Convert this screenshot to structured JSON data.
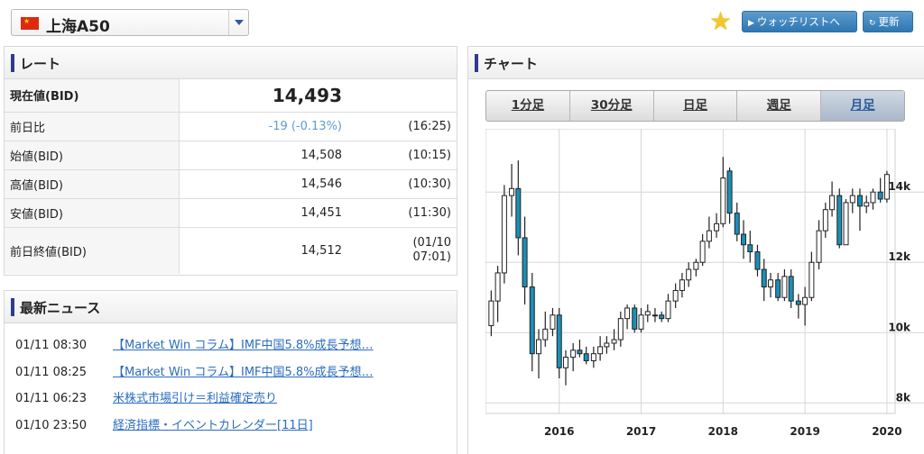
{
  "header": {
    "symbol": "上海A50",
    "flag_icon": "china-flag-icon",
    "watchlist_label": "ウォッチリストへ",
    "refresh_label": "更新"
  },
  "rate": {
    "title": "レート",
    "rows": [
      {
        "label": "現在値(BID)",
        "value": "14,493",
        "time": ""
      },
      {
        "label": "前日比",
        "value": "-19 (-0.13%)",
        "time": "(16:25)"
      },
      {
        "label": "始値(BID)",
        "value": "14,508",
        "time": "(10:15)"
      },
      {
        "label": "高値(BID)",
        "value": "14,546",
        "time": "(10:30)"
      },
      {
        "label": "安値(BID)",
        "value": "14,451",
        "time": "(11:30)"
      },
      {
        "label": "前日終値(BID)",
        "value": "14,512",
        "time_line1": "(01/10",
        "time_line2": "07:01)"
      }
    ]
  },
  "news": {
    "title": "最新ニュース",
    "items": [
      {
        "time": "01/11 08:30",
        "headline": "【Market Win コラム】IMF中国5.8%成長予想…"
      },
      {
        "time": "01/11 08:25",
        "headline": "【Market Win コラム】IMF中国5.8%成長予想…"
      },
      {
        "time": "01/11 06:23",
        "headline": "米株式市場引け＝利益確定売り"
      },
      {
        "time": "01/10 23:50",
        "headline": "経済指標・イベントカレンダー[11日]"
      }
    ]
  },
  "chart": {
    "title": "チャート",
    "tabs": [
      "1分足",
      "30分足",
      "日足",
      "週足",
      "月足"
    ],
    "active_tab": 4
  },
  "colors": {
    "up": "#ffffff",
    "down": "#1b8fb8",
    "grid": "#d6d6d6",
    "accent": "#2d3d8a"
  },
  "chart_data": {
    "type": "candlestick",
    "x_ticks": [
      "2016",
      "2017",
      "2018",
      "2019",
      "2020"
    ],
    "y_ticks": [
      "8k",
      "10k",
      "12k",
      "14k"
    ],
    "y_tick_values": [
      8000,
      10000,
      12000,
      14000
    ],
    "ylim": [
      7700,
      15800
    ],
    "xlim": [
      2015.1,
      2020.1
    ],
    "candles": [
      {
        "t": 2015.17,
        "o": 10200,
        "h": 11200,
        "l": 9900,
        "c": 10900
      },
      {
        "t": 2015.25,
        "o": 10900,
        "h": 11900,
        "l": 10300,
        "c": 11700
      },
      {
        "t": 2015.33,
        "o": 11700,
        "h": 14200,
        "l": 11400,
        "c": 13900
      },
      {
        "t": 2015.42,
        "o": 13900,
        "h": 14800,
        "l": 13300,
        "c": 14100
      },
      {
        "t": 2015.5,
        "o": 14100,
        "h": 14900,
        "l": 12200,
        "c": 12700
      },
      {
        "t": 2015.58,
        "o": 12700,
        "h": 13300,
        "l": 10800,
        "c": 11300
      },
      {
        "t": 2015.67,
        "o": 11300,
        "h": 11700,
        "l": 8900,
        "c": 9400
      },
      {
        "t": 2015.75,
        "o": 9400,
        "h": 10100,
        "l": 8700,
        "c": 9800
      },
      {
        "t": 2015.83,
        "o": 9800,
        "h": 10600,
        "l": 9600,
        "c": 10100
      },
      {
        "t": 2015.92,
        "o": 10100,
        "h": 10700,
        "l": 9900,
        "c": 10500
      },
      {
        "t": 2016.0,
        "o": 10500,
        "h": 10700,
        "l": 8700,
        "c": 9000
      },
      {
        "t": 2016.08,
        "o": 9000,
        "h": 9500,
        "l": 8500,
        "c": 9300
      },
      {
        "t": 2016.17,
        "o": 9300,
        "h": 9700,
        "l": 8900,
        "c": 9500
      },
      {
        "t": 2016.25,
        "o": 9500,
        "h": 9800,
        "l": 9300,
        "c": 9400
      },
      {
        "t": 2016.33,
        "o": 9400,
        "h": 9600,
        "l": 9100,
        "c": 9200
      },
      {
        "t": 2016.42,
        "o": 9200,
        "h": 9600,
        "l": 9000,
        "c": 9400
      },
      {
        "t": 2016.5,
        "o": 9400,
        "h": 9900,
        "l": 9200,
        "c": 9600
      },
      {
        "t": 2016.58,
        "o": 9600,
        "h": 9900,
        "l": 9400,
        "c": 9700
      },
      {
        "t": 2016.67,
        "o": 9700,
        "h": 10100,
        "l": 9500,
        "c": 9800
      },
      {
        "t": 2016.75,
        "o": 9800,
        "h": 10600,
        "l": 9600,
        "c": 10400
      },
      {
        "t": 2016.83,
        "o": 10400,
        "h": 10800,
        "l": 10100,
        "c": 10700
      },
      {
        "t": 2016.92,
        "o": 10700,
        "h": 10800,
        "l": 10000,
        "c": 10100
      },
      {
        "t": 2017.0,
        "o": 10100,
        "h": 10700,
        "l": 10000,
        "c": 10500
      },
      {
        "t": 2017.08,
        "o": 10500,
        "h": 10800,
        "l": 10300,
        "c": 10600
      },
      {
        "t": 2017.17,
        "o": 10500,
        "h": 10700,
        "l": 10300,
        "c": 10500
      },
      {
        "t": 2017.25,
        "o": 10500,
        "h": 10600,
        "l": 10300,
        "c": 10400
      },
      {
        "t": 2017.33,
        "o": 10400,
        "h": 11100,
        "l": 10300,
        "c": 10900
      },
      {
        "t": 2017.42,
        "o": 10900,
        "h": 11400,
        "l": 10700,
        "c": 11200
      },
      {
        "t": 2017.5,
        "o": 11200,
        "h": 11700,
        "l": 11000,
        "c": 11500
      },
      {
        "t": 2017.58,
        "o": 11500,
        "h": 12000,
        "l": 11300,
        "c": 11800
      },
      {
        "t": 2017.67,
        "o": 11800,
        "h": 12100,
        "l": 11600,
        "c": 12000
      },
      {
        "t": 2017.75,
        "o": 12000,
        "h": 12800,
        "l": 11900,
        "c": 12600
      },
      {
        "t": 2017.83,
        "o": 12600,
        "h": 13300,
        "l": 12400,
        "c": 12900
      },
      {
        "t": 2017.92,
        "o": 12900,
        "h": 13400,
        "l": 12700,
        "c": 13100
      },
      {
        "t": 2018.0,
        "o": 13100,
        "h": 15000,
        "l": 13000,
        "c": 14400
      },
      {
        "t": 2018.08,
        "o": 14600,
        "h": 14700,
        "l": 13100,
        "c": 13400
      },
      {
        "t": 2018.17,
        "o": 13400,
        "h": 13700,
        "l": 12600,
        "c": 12800
      },
      {
        "t": 2018.25,
        "o": 12800,
        "h": 13200,
        "l": 12100,
        "c": 12500
      },
      {
        "t": 2018.33,
        "o": 12500,
        "h": 12900,
        "l": 12000,
        "c": 12300
      },
      {
        "t": 2018.42,
        "o": 12300,
        "h": 12500,
        "l": 11600,
        "c": 11800
      },
      {
        "t": 2018.5,
        "o": 11800,
        "h": 12100,
        "l": 10900,
        "c": 11300
      },
      {
        "t": 2018.58,
        "o": 11300,
        "h": 11700,
        "l": 11000,
        "c": 11500
      },
      {
        "t": 2018.67,
        "o": 11500,
        "h": 11700,
        "l": 10900,
        "c": 11000
      },
      {
        "t": 2018.75,
        "o": 11000,
        "h": 11800,
        "l": 10900,
        "c": 11600
      },
      {
        "t": 2018.83,
        "o": 11600,
        "h": 11800,
        "l": 10700,
        "c": 10900
      },
      {
        "t": 2018.92,
        "o": 10900,
        "h": 11100,
        "l": 10400,
        "c": 10800
      },
      {
        "t": 2019.0,
        "o": 10800,
        "h": 11300,
        "l": 10200,
        "c": 11000
      },
      {
        "t": 2019.08,
        "o": 11000,
        "h": 12300,
        "l": 10900,
        "c": 12000
      },
      {
        "t": 2019.17,
        "o": 12000,
        "h": 13200,
        "l": 11800,
        "c": 12900
      },
      {
        "t": 2019.25,
        "o": 12900,
        "h": 13700,
        "l": 12700,
        "c": 13500
      },
      {
        "t": 2019.33,
        "o": 13500,
        "h": 14300,
        "l": 13300,
        "c": 13900
      },
      {
        "t": 2019.42,
        "o": 13900,
        "h": 14100,
        "l": 12400,
        "c": 12500
      },
      {
        "t": 2019.5,
        "o": 12500,
        "h": 13800,
        "l": 12500,
        "c": 13700
      },
      {
        "t": 2019.58,
        "o": 13700,
        "h": 14100,
        "l": 13400,
        "c": 13900
      },
      {
        "t": 2019.67,
        "o": 13900,
        "h": 14100,
        "l": 12900,
        "c": 13600
      },
      {
        "t": 2019.75,
        "o": 13600,
        "h": 13900,
        "l": 13400,
        "c": 13700
      },
      {
        "t": 2019.83,
        "o": 13700,
        "h": 14100,
        "l": 13500,
        "c": 14000
      },
      {
        "t": 2019.92,
        "o": 14000,
        "h": 14400,
        "l": 13700,
        "c": 13800
      },
      {
        "t": 2020.0,
        "o": 13800,
        "h": 14600,
        "l": 13700,
        "c": 14500
      }
    ]
  }
}
